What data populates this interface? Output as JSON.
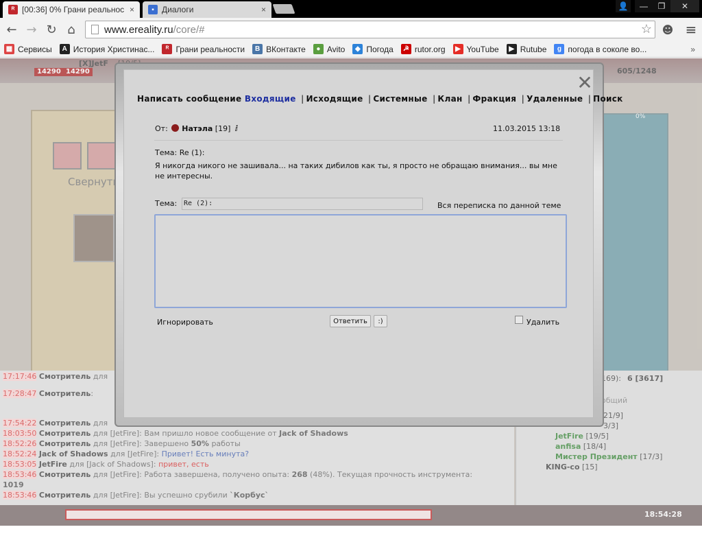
{
  "browser": {
    "tabs": [
      {
        "title": "[00:36] 0% Грани реальнос",
        "close": "×",
        "favicon": "ᴿ",
        "fav_color": "#c1272d",
        "active": true
      },
      {
        "title": "Диалоги",
        "close": "×",
        "favicon": "▪",
        "fav_color": "#3b6fd1",
        "active": false
      }
    ],
    "window_buttons": {
      "user": "👤",
      "minimize": "—",
      "restore": "❐",
      "close": "✕"
    },
    "nav": {
      "back": "←",
      "forward": "→",
      "reload": "↻",
      "home": "⌂"
    },
    "url": {
      "domain": "www.ereality.ru",
      "path": "/core/#"
    },
    "star": "☆",
    "menu_icon": "≡",
    "extension_icon": "☻",
    "bookmarks": [
      {
        "label": "Сервисы",
        "icon": "▦",
        "color": "#d44"
      },
      {
        "label": "История Христинас...",
        "icon": "A",
        "color": "#222"
      },
      {
        "label": "Грани реальности",
        "icon": "ᴿ",
        "color": "#c1272d"
      },
      {
        "label": "ВКонтакте",
        "icon": "B",
        "color": "#4a76a8"
      },
      {
        "label": "Avito",
        "icon": "●",
        "color": "#5a9e3f"
      },
      {
        "label": "Погода",
        "icon": "◆",
        "color": "#2d83d9"
      },
      {
        "label": "rutor.org",
        "icon": "☭",
        "color": "#c00"
      },
      {
        "label": "YouTube",
        "icon": "▶",
        "color": "#e52d27"
      },
      {
        "label": "Rutube",
        "icon": "▶",
        "color": "#222"
      },
      {
        "label": "погода в соколе во...",
        "icon": "g",
        "color": "#4285f4"
      }
    ],
    "more": "»"
  },
  "game": {
    "player_tag": "[X]JetF",
    "level": "[19/5]",
    "hp_a": "14290",
    "hp_b": "14290",
    "gold": "605/1248",
    "minimize_label": "Свернуть",
    "percent": "0%",
    "online_count_prefix": "169): ",
    "online_count": "6 [3617]",
    "messages_label": "общий",
    "time": "18:54:28",
    "chat": [
      {
        "time": "17:17:46",
        "author": "Смотритель",
        "text": " для"
      },
      {
        "time": "17:28:47",
        "author": "Смотритель",
        "text": ":"
      },
      {
        "time": "17:54:22",
        "author": "Смотритель",
        "text": " для"
      },
      {
        "time": "18:03:50",
        "author": "Смотритель",
        "text": " для [JetFire]: Вам пришло новое сообщение от ",
        "bold_tail": "Jack of Shadows"
      },
      {
        "time": "18:52:26",
        "author": "Смотритель",
        "text": " для [JetFire]: Завершено ",
        "bold_tail": "50%",
        "tail": " работы"
      },
      {
        "time": "18:52:24",
        "author": "Jack of Shadows",
        "text": " для [JetFire]: ",
        "pm": "Привет! Есть минута?"
      },
      {
        "time": "18:53:05",
        "author": "JetFire",
        "text": " для [Jack of Shadows]: ",
        "red": "привет, есть"
      },
      {
        "time": "18:53:46",
        "author": "Смотритель",
        "text": " для [JetFire]: Работа завершена, получено опыта: ",
        "bold_tail": "268",
        "tail": " (48%). Текущая прочность инструмента:"
      },
      {
        "time": "",
        "author": "1019",
        "text": ""
      },
      {
        "time": "18:53:46",
        "author": "Смотритель",
        "text": " для [JetFire]: Вы успешно срубили ",
        "bold_tail": "`Корбус`"
      }
    ],
    "online": [
      {
        "name": "",
        "level": "21/9]"
      },
      {
        "name": "",
        "level": "3/3]"
      },
      {
        "name": "JetFire",
        "level": "[19/5]",
        "color": "#2a7a2a"
      },
      {
        "name": "anfisa",
        "level": "[18/4]",
        "color": "#2a7a2a"
      },
      {
        "name": "Мистер Президент",
        "level": "[17/3]",
        "color": "#2a7a2a"
      },
      {
        "name": "KING-co",
        "level": "[15]",
        "color": "#222"
      }
    ]
  },
  "dialog": {
    "close": "✕",
    "nav": {
      "compose": "Написать сообщение",
      "inbox": "Входящие",
      "outbox": "Исходящие",
      "system": "Системные",
      "clan": "Клан",
      "faction": "Фракция",
      "deleted": "Удаленные",
      "search": "Поиск",
      "sep": "|"
    },
    "from_label": "От:",
    "from_name": "Натэла",
    "from_level": "[19]",
    "from_info": "ⅈ",
    "date": "11.03.2015 13:18",
    "subject_line": "Тема: Re (1):",
    "body": "Я никогда никого не зашивала... на таких дибилов как ты, я просто не обращаю внимания... вы мне не интересны.",
    "reply_subject_label": "Тема:",
    "reply_subject_value": "Re (2):",
    "thread_link": "Вся переписка по данной теме",
    "reply_text": "",
    "ignore_link": "Игнорировать",
    "reply_button": "Ответить",
    "smile_button": ":)",
    "delete_label": "Удалить"
  }
}
